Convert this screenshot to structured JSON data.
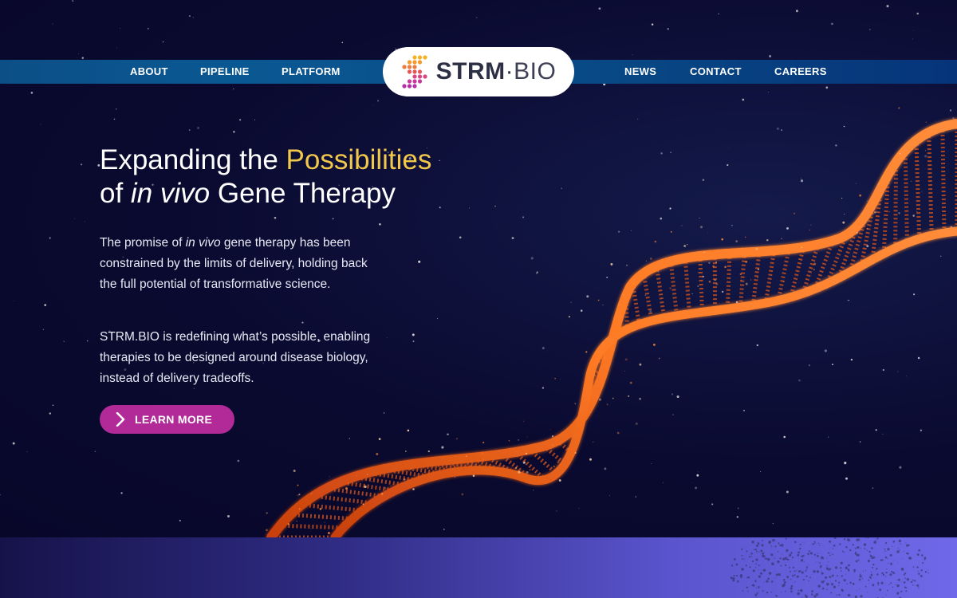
{
  "nav": {
    "left": [
      {
        "label": "ABOUT"
      },
      {
        "label": "PIPELINE"
      },
      {
        "label": "PLATFORM"
      }
    ],
    "right": [
      {
        "label": "NEWS"
      },
      {
        "label": "CONTACT"
      },
      {
        "label": "CAREERS"
      }
    ]
  },
  "logo": {
    "strm": "STRM",
    "dot": "·",
    "bio": "BIO"
  },
  "hero": {
    "headline_part1": "Expanding the ",
    "headline_accent": "Possibilities",
    "headline_part2": "of ",
    "headline_italic": "in vivo",
    "headline_part3": " Gene Therapy",
    "para1_a": "The promise of ",
    "para1_italic": "in vivo",
    "para1_b": " gene therapy has been constrained by the limits of delivery, holding back the full potential of transformative science.",
    "para2": "STRM.BIO is redefining what’s possible, enabling therapies to be designed around disease biology, instead of delivery tradeoffs.",
    "cta_label": "LEARN MORE"
  },
  "colors": {
    "accent_yellow": "#f2c84b",
    "cta_magenta": "#b22a98",
    "nav_blue": "#0a5893",
    "dna_orange": "#ff6a1a"
  },
  "icons": {
    "cta": "chevron-right-icon",
    "logo_mark": "dotted-s-icon"
  }
}
